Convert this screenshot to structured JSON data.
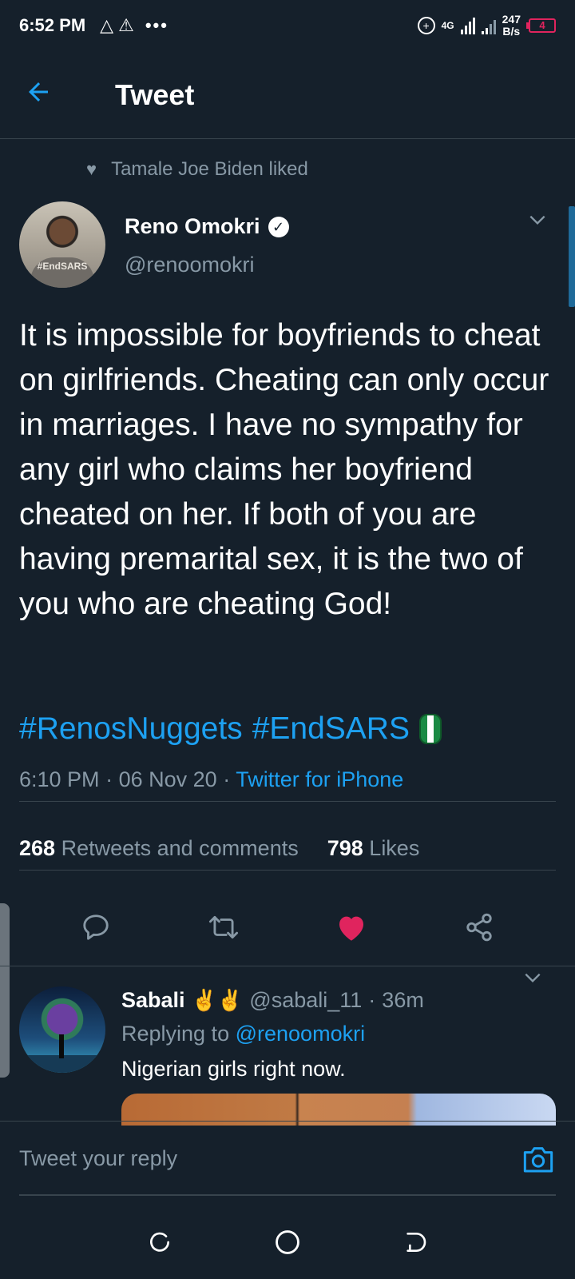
{
  "status_bar": {
    "time": "6:52 PM",
    "net_speed_value": "247",
    "net_speed_unit": "B/s",
    "battery_level": "4",
    "network": "4G"
  },
  "header": {
    "title": "Tweet"
  },
  "social_context": "Tamale Joe Biden liked",
  "tweet": {
    "author_name": "Reno Omokri",
    "author_handle": "@renoomokri",
    "avatar_text": "#EndSARS",
    "text": "It is impossible for boyfriends to cheat on girlfriends. Cheating can only occur in marriages. I have no sympathy for any girl who claims her boyfriend cheated on her. If both of you are having premarital sex, it is the two of you who are cheating God!",
    "hashtag_1": "#RenosNuggets",
    "hashtag_2": "#EndSARS",
    "time": "6:10 PM",
    "date": "06 Nov 20",
    "source": "Twitter for iPhone",
    "retweets_count": "268",
    "retweets_label": "Retweets and comments",
    "likes_count": "798",
    "likes_label": "Likes",
    "liked": true
  },
  "reply": {
    "author_name": "Sabali",
    "emoji": "✌️✌️",
    "author_handle": "@sabali_11",
    "time_ago": "36m",
    "replying_prefix": "Replying to",
    "replying_to": "@renoomokri",
    "text": "Nigerian girls right now."
  },
  "composer": {
    "placeholder": "Tweet your reply"
  },
  "colors": {
    "background": "#15202b",
    "accent": "#1da1f2",
    "muted": "#8899a6",
    "like": "#e0245e",
    "divider": "#38444d"
  },
  "icons": {
    "back": "arrow-left-icon",
    "reply": "comment-icon",
    "retweet": "retweet-icon",
    "like": "heart-filled-icon",
    "share": "share-icon",
    "camera": "camera-icon"
  }
}
